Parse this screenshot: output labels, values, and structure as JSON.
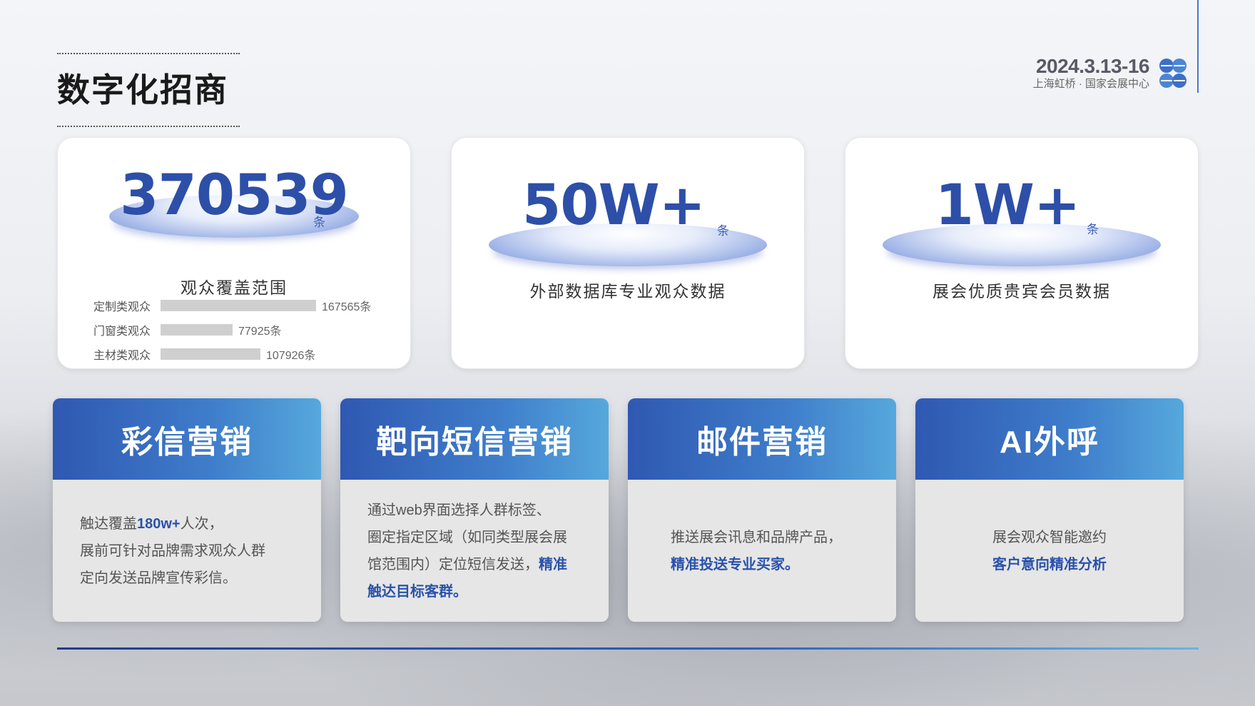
{
  "header": {
    "title": "数字化招商",
    "event_date": "2024.3.13-16",
    "event_venue": "上海虹桥 · 国家会展中心",
    "logo_icon": "clover-logo-icon"
  },
  "stats": [
    {
      "value": "370539",
      "unit": "条",
      "label": "观众覆盖范围",
      "breakdown": [
        {
          "label": "定制类观众",
          "value": 167565,
          "text": "167565条"
        },
        {
          "label": "门窗类观众",
          "value": 77925,
          "text": "77925条"
        },
        {
          "label": "主材类观众",
          "value": 107926,
          "text": "107926条"
        }
      ]
    },
    {
      "value": "50W+",
      "unit": "条",
      "label": "外部数据库专业观众数据"
    },
    {
      "value": "1W+",
      "unit": "条",
      "label": "展会优质贵宾会员数据"
    }
  ],
  "marketing": [
    {
      "title": "彩信营销",
      "lines": [
        {
          "pre": "触达覆盖",
          "hl": "180w+",
          "post": "人次，"
        },
        {
          "pre": "展前可针对品牌需求观众人群",
          "hl": "",
          "post": ""
        },
        {
          "pre": "定向发送品牌宣传彩信。",
          "hl": "",
          "post": ""
        }
      ]
    },
    {
      "title": "靶向短信营销",
      "lines": [
        {
          "pre": "通过web界面选择人群标签、",
          "hl": "",
          "post": ""
        },
        {
          "pre": "圈定指定区域（如同类型展会展",
          "hl": "",
          "post": ""
        },
        {
          "pre": "馆范围内）定位短信发送，",
          "hl": "精准",
          "post": ""
        },
        {
          "pre": "",
          "hl": "触达目标客群。",
          "post": ""
        }
      ]
    },
    {
      "title": "邮件营销",
      "lines": [
        {
          "pre": "推送展会讯息和品牌产品，",
          "hl": "",
          "post": ""
        },
        {
          "pre": "",
          "hl": "精准投送专业买家。",
          "post": ""
        }
      ]
    },
    {
      "title": "AI外呼",
      "lines": [
        {
          "pre": "展会观众智能邀约",
          "hl": "",
          "post": ""
        },
        {
          "pre": "",
          "hl": "客户意向精准分析",
          "post": ""
        }
      ]
    }
  ],
  "colors": {
    "accent": "#2d4fa8",
    "header_gradient_start": "#2f58b2",
    "header_gradient_end": "#56a8dc",
    "bar": "#cfcfcf"
  }
}
